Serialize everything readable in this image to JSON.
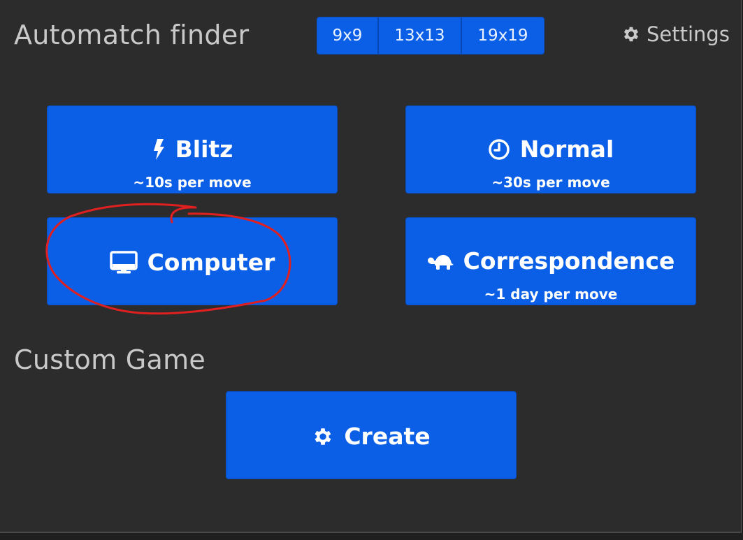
{
  "automatch": {
    "title": "Automatch finder",
    "board_sizes": [
      "9x9",
      "13x13",
      "19x19"
    ],
    "settings_label": "Settings"
  },
  "speeds": {
    "blitz": {
      "label": "Blitz",
      "subtitle": "~10s per move",
      "icon": "lightning-icon"
    },
    "normal": {
      "label": "Normal",
      "subtitle": "~30s per move",
      "icon": "clock-icon"
    },
    "computer": {
      "label": "Computer",
      "icon": "desktop-icon"
    },
    "correspondence": {
      "label": "Correspondence",
      "subtitle": "~1 day per move",
      "icon": "turtle-icon"
    }
  },
  "custom": {
    "title": "Custom Game",
    "create_label": "Create",
    "icon": "gear-icon"
  },
  "colors": {
    "panel_bg": "#2c2c2c",
    "button_blue": "#0b5fe6",
    "heading_text": "#c9c9c9",
    "annotation_red": "#e02020"
  }
}
